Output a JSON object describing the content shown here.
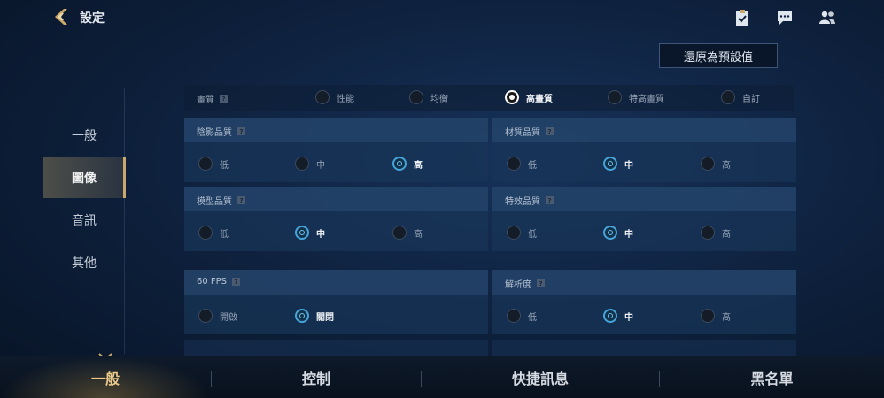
{
  "header": {
    "title": "設定",
    "icons": [
      "back-chevron-icon",
      "clipboard-check-icon",
      "chat-icon",
      "friends-icon"
    ]
  },
  "reset_button": "還原為預設值",
  "left_nav": {
    "items": [
      {
        "label": "一般",
        "active": false
      },
      {
        "label": "圖像",
        "active": true
      },
      {
        "label": "音訊",
        "active": false
      },
      {
        "label": "其他",
        "active": false
      }
    ]
  },
  "quality": {
    "label": "畫質",
    "help": "?",
    "options": [
      "性能",
      "均衡",
      "高畫質",
      "特高畫質",
      "自訂"
    ],
    "selected": "高畫質"
  },
  "panels": {
    "shadow": {
      "title": "陰影品質",
      "help": "?",
      "options": [
        "低",
        "中",
        "高"
      ],
      "selected": "高"
    },
    "material": {
      "title": "材質品質",
      "help": "?",
      "options": [
        "低",
        "中",
        "高"
      ],
      "selected": "中"
    },
    "model": {
      "title": "模型品質",
      "help": "?",
      "options": [
        "低",
        "中",
        "高"
      ],
      "selected": "中"
    },
    "effects": {
      "title": "特效品質",
      "help": "?",
      "options": [
        "低",
        "中",
        "高"
      ],
      "selected": "中"
    },
    "fps": {
      "title": "60 FPS",
      "help": "?",
      "options": [
        "開啟",
        "關閉"
      ],
      "selected": "關閉"
    },
    "resolution": {
      "title": "解析度",
      "help": "?",
      "options": [
        "低",
        "中",
        "高"
      ],
      "selected": "中"
    }
  },
  "bottom_tabs": [
    {
      "label": "一般",
      "active": true
    },
    {
      "label": "控制",
      "active": false
    },
    {
      "label": "快捷訊息",
      "active": false
    },
    {
      "label": "黑名單",
      "active": false
    }
  ],
  "colors": {
    "accent_gold": "#c9a86a",
    "radio_blue": "#48a4d8",
    "panel_bg": "#183458"
  }
}
